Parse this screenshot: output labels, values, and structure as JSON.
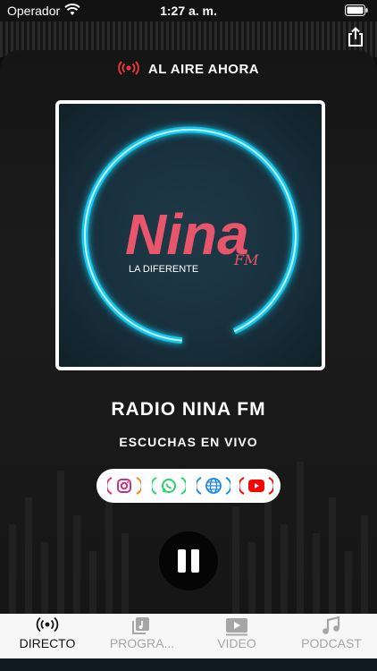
{
  "status": {
    "carrier": "Operador",
    "time": "1:27 a. m."
  },
  "live": {
    "label": "AL AIRE AHORA"
  },
  "artwork": {
    "logo_main": "Nina",
    "logo_tag": "LA DIFERENTE",
    "logo_fm": "FM"
  },
  "station": {
    "name": "RADIO NINA FM",
    "subtitle": "ESCUCHAS EN VIVO"
  },
  "social": [
    {
      "name": "instagram",
      "color": "#e1306c"
    },
    {
      "name": "whatsapp",
      "color": "#25d366"
    },
    {
      "name": "website",
      "color": "#1e88e5"
    },
    {
      "name": "youtube",
      "color": "#ff0000"
    }
  ],
  "player": {
    "state": "playing"
  },
  "tabs": [
    {
      "label": "DIRECTO",
      "icon": "broadcast-icon",
      "active": true
    },
    {
      "label": "PROGRA...",
      "icon": "playlist-icon",
      "active": false
    },
    {
      "label": "VIDEO",
      "icon": "video-icon",
      "active": false
    },
    {
      "label": "PODCAST",
      "icon": "music-note-icon",
      "active": false
    }
  ],
  "colors": {
    "accent_live": "#e53935",
    "glow": "#19c8f0",
    "logo_red": "#e9566b"
  }
}
